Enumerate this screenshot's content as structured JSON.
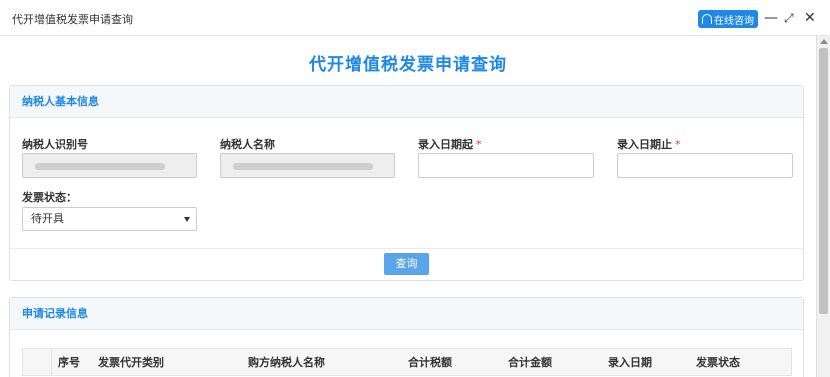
{
  "window": {
    "title": "代开增值税发票申请查询",
    "online_label": "在线咨询",
    "minimize": "—",
    "maximize": "⤢",
    "close": "✕"
  },
  "page": {
    "heading": "代开增值税发票申请查询"
  },
  "basic_info": {
    "title": "纳税人基本信息",
    "taxpayer_id_label": "纳税人识别号",
    "taxpayer_name_label": "纳税人名称",
    "date_start_label": "录入日期起",
    "date_end_label": "录入日期止",
    "required_mark": "*",
    "invoice_status_label": "发票状态：",
    "invoice_status_value": "待开具",
    "query_label": "查询"
  },
  "records": {
    "title": "申请记录信息",
    "columns": [
      "序号",
      "发票代开类别",
      "购方纳税人名称",
      "合计税额",
      "合计金额",
      "录入日期",
      "发票状态"
    ]
  },
  "colors": {
    "accent": "#1e88e5",
    "button": "#5aa5e9",
    "required": "#e53935"
  }
}
